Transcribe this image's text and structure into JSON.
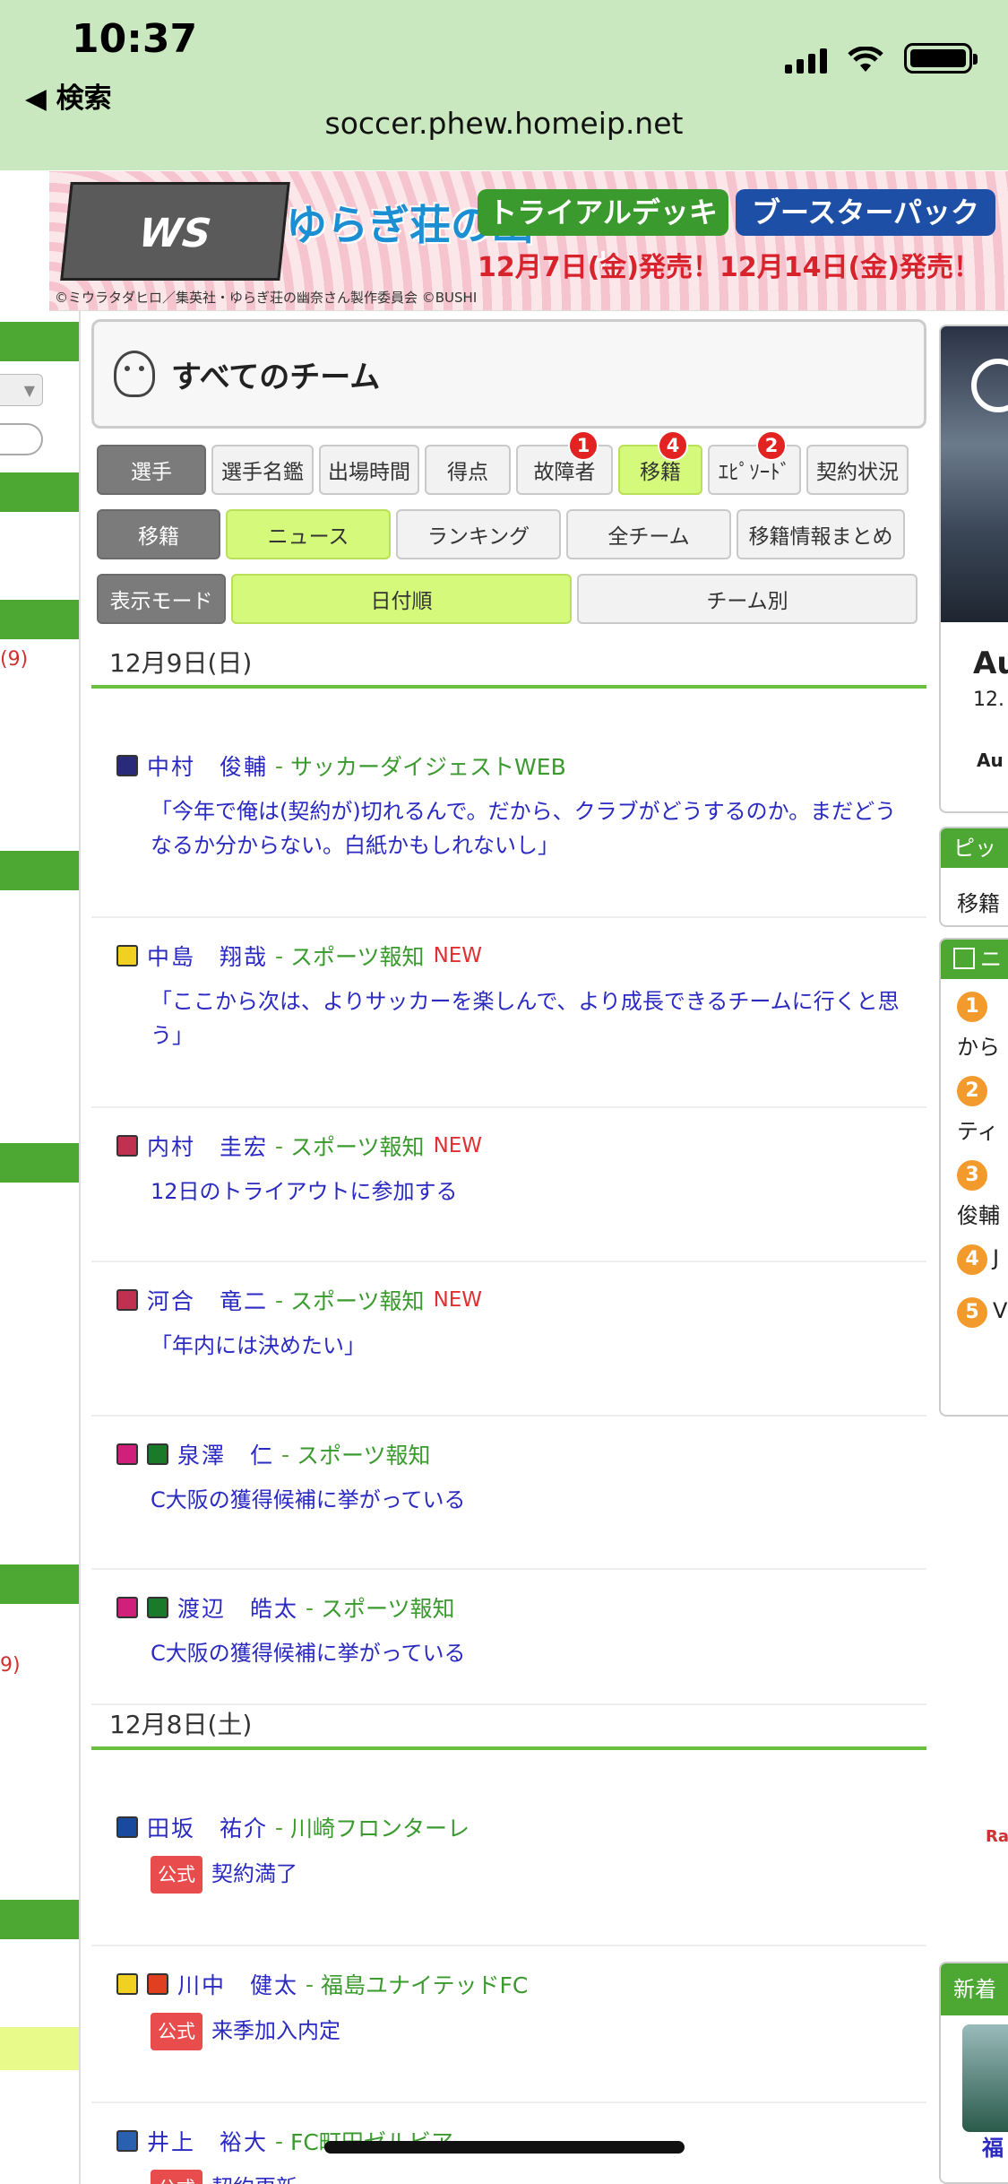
{
  "status_bar": {
    "time": "10:37",
    "back_label": "◀ 検索",
    "url": "soccer.phew.homeip.net"
  },
  "banner": {
    "logo_text": "WS",
    "title": "ゆらぎ荘の幽奈さん",
    "button_trial": "トライアルデッキ+",
    "button_booster": "ブースターパック",
    "release": "12月7日(金)発売！12月14日(金)発売！",
    "copyright": "©ミウラタダヒロ／集英社・ゆらぎ荘の幽奈さん製作委員会 ©BUSHI"
  },
  "left_column": {
    "count_a": "(9)",
    "count_b": "9)"
  },
  "page": {
    "title": "すべてのチーム"
  },
  "tabs_row1": [
    {
      "label": "選手",
      "style": "dark",
      "badge": ""
    },
    {
      "label": "選手名鑑",
      "style": "",
      "badge": ""
    },
    {
      "label": "出場時間",
      "style": "",
      "badge": ""
    },
    {
      "label": "得点",
      "style": "",
      "badge": ""
    },
    {
      "label": "故障者",
      "style": "",
      "badge": "1"
    },
    {
      "label": "移籍",
      "style": "lime",
      "badge": "4"
    },
    {
      "label": "ｴﾋﾟｿｰﾄﾞ",
      "style": "",
      "badge": "2"
    },
    {
      "label": "契約状況",
      "style": "",
      "badge": ""
    }
  ],
  "tabs_row2": [
    {
      "label": "移籍",
      "style": "dark"
    },
    {
      "label": "ニュース",
      "style": "lime"
    },
    {
      "label": "ランキング",
      "style": ""
    },
    {
      "label": "全チーム",
      "style": ""
    },
    {
      "label": "移籍情報まとめ",
      "style": ""
    }
  ],
  "tabs_row3": [
    {
      "label": "表示モード",
      "style": "dark"
    },
    {
      "label": "日付順",
      "style": "lime"
    },
    {
      "label": "チーム別",
      "style": ""
    }
  ],
  "sections": [
    {
      "date": "12月9日(日)",
      "items": [
        {
          "name": "中村　俊輔",
          "source": "サッカーダイジェストWEB",
          "new": "",
          "text": "「今年で俺は(契約が)切れるんで。だから、クラブがどうするのか。まだどうなるか分からない。白紙かもしれないし」",
          "official": "",
          "icons": [
            "#2a2a7a"
          ]
        },
        {
          "name": "中島　翔哉",
          "source": "スポーツ報知",
          "new": "NEW",
          "text": "「ここから次は、よりサッカーを楽しんで、より成長できるチームに行くと思う」",
          "official": "",
          "icons": [
            "#f0d020"
          ]
        },
        {
          "name": "内村　圭宏",
          "source": "スポーツ報知",
          "new": "NEW",
          "text": "12日のトライアウトに参加する",
          "official": "",
          "icons": [
            "#c03050"
          ]
        },
        {
          "name": "河合　竜二",
          "source": "スポーツ報知",
          "new": "NEW",
          "text": "「年内には決めたい」",
          "official": "",
          "icons": [
            "#c03050"
          ]
        },
        {
          "name": "泉澤　仁",
          "source": "スポーツ報知",
          "new": "",
          "text": "C大阪の獲得候補に挙がっている",
          "official": "",
          "icons": [
            "#d0207a",
            "#1a7a2a"
          ]
        },
        {
          "name": "渡辺　皓太",
          "source": "スポーツ報知",
          "new": "",
          "text": "C大阪の獲得候補に挙がっている",
          "official": "",
          "icons": [
            "#d0207a",
            "#1a7a2a"
          ]
        }
      ]
    },
    {
      "date": "12月8日(土)",
      "items": [
        {
          "name": "田坂　祐介",
          "source": "川崎フロンターレ",
          "new": "",
          "text": "契約満了",
          "official": "公式",
          "icons": [
            "#1a4aa0"
          ]
        },
        {
          "name": "川中　健太",
          "source": "福島ユナイテッドFC",
          "new": "",
          "text": "来季加入内定",
          "official": "公式",
          "icons": [
            "#f0d020",
            "#e04020"
          ]
        },
        {
          "name": "井上　裕大",
          "source": "FC町田ゼルビア",
          "new": "",
          "text": "契約更新",
          "official": "公式",
          "icons": [
            "#2a60b0"
          ]
        }
      ]
    }
  ],
  "right_column": {
    "ad_text1": "Au",
    "ad_text2": "12.",
    "ad_text3": "Au",
    "pickup_header": "ピッ",
    "pickup_text": "移籍",
    "ranking_header": "ニ",
    "ranking": [
      {
        "rank": "1",
        "text": "から"
      },
      {
        "rank": "2",
        "text": "ティ"
      },
      {
        "rank": "3",
        "text": "俊輔"
      },
      {
        "rank": "4",
        "text": "J"
      },
      {
        "rank": "5",
        "text": "V指"
      }
    ],
    "new_header": "新着",
    "new_text": "福"
  },
  "colors": {
    "green": "#4ca832",
    "lime": "#d4f97b",
    "link": "#2a2ac2",
    "badge": "#e32222"
  }
}
